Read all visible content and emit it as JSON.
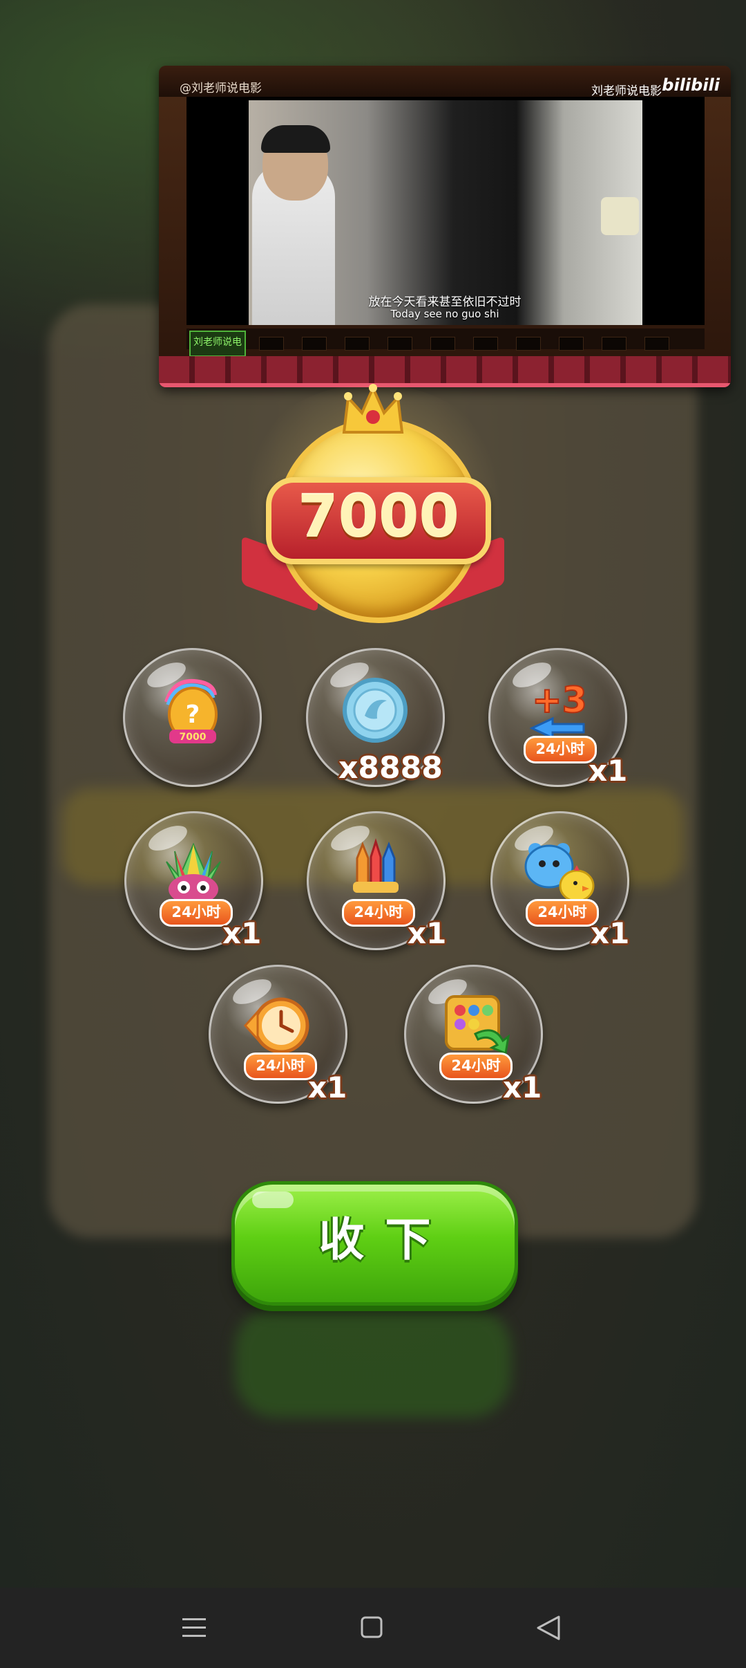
{
  "video": {
    "watermark_left": "@刘老师说电影",
    "watermark_right": "刘老师说电影",
    "logo": "bilibili",
    "subtitle_cn": "放在今天看来甚至依旧不过时",
    "subtitle_en": "Today see no guo shi",
    "channel_badge": "刘老师说电影"
  },
  "reward": {
    "amount": "7000",
    "items": [
      {
        "icon": "mystery-egg-icon",
        "label": "",
        "qty": ""
      },
      {
        "icon": "silver-coin-icon",
        "label": "",
        "qty": "x8888"
      },
      {
        "icon": "plus-three-moves-icon",
        "label": "24小时",
        "qty": "x1",
        "overlay": "+3"
      },
      {
        "icon": "rainbow-bird-icon",
        "label": "24小时",
        "qty": "x1"
      },
      {
        "icon": "rocket-icon",
        "label": "24小时",
        "qty": "x1"
      },
      {
        "icon": "blue-bear-chick-icon",
        "label": "24小时",
        "qty": "x1"
      },
      {
        "icon": "clock-icon",
        "label": "24小时",
        "qty": "x1"
      },
      {
        "icon": "shuffle-board-icon",
        "label": "24小时",
        "qty": "x1"
      }
    ],
    "egg_label": "7000"
  },
  "collect_button": {
    "label": "收下"
  },
  "navbar": {
    "menu_icon": "menu-icon",
    "home_icon": "home-square-icon",
    "back_icon": "back-triangle-icon"
  },
  "colors": {
    "button_green": "#5fcf14",
    "tag_orange": "#e8551d",
    "plaque_red": "#b7202b",
    "gold": "#f8d24a"
  }
}
